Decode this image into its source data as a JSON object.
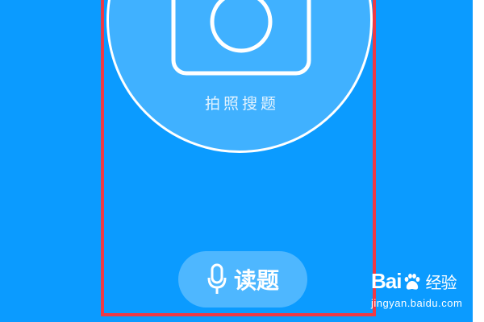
{
  "camera": {
    "label": "拍照搜题",
    "icon": "camera-icon"
  },
  "voice": {
    "label": "读题",
    "icon": "microphone-icon"
  },
  "watermark": {
    "brand_left": "Bai",
    "brand_right": "经验",
    "url": "jingyan.baidu.com"
  },
  "colors": {
    "background": "#0b9bff",
    "highlight": "#ee3a45",
    "foreground": "#ffffff"
  }
}
